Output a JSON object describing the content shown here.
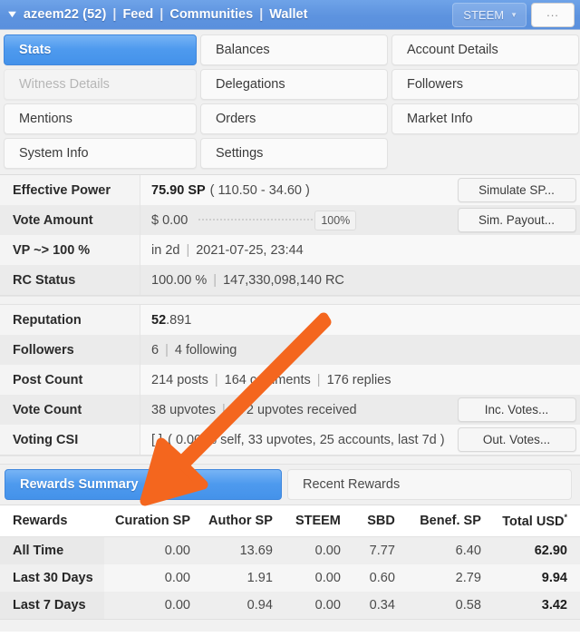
{
  "titlebar": {
    "caret_icon": "caret-down-icon",
    "user": "azeem22 (52)",
    "nav": [
      "Feed",
      "Communities",
      "Wallet"
    ],
    "separator": "|",
    "network_label": "STEEM",
    "network_caret_icon": "caret-down-icon",
    "more_label": "...",
    "accent": "#5d93df"
  },
  "tabs": {
    "rows": [
      [
        {
          "label": "Stats",
          "state": "active"
        },
        {
          "label": "Balances",
          "state": "normal"
        },
        {
          "label": "Account Details",
          "state": "normal"
        }
      ],
      [
        {
          "label": "Witness Details",
          "state": "disabled"
        },
        {
          "label": "Delegations",
          "state": "normal"
        },
        {
          "label": "Followers",
          "state": "normal"
        }
      ],
      [
        {
          "label": "Mentions",
          "state": "normal"
        },
        {
          "label": "Orders",
          "state": "normal"
        },
        {
          "label": "Market Info",
          "state": "normal"
        }
      ],
      [
        {
          "label": "System Info",
          "state": "normal"
        },
        {
          "label": "Settings",
          "state": "normal"
        },
        {
          "label": "",
          "state": "empty"
        }
      ]
    ],
    "active_color": "#4492ea"
  },
  "stats_group_1": [
    {
      "label": "Effective Power",
      "value_bold": "75.90 SP",
      "value_rest": "( 110.50 - 34.60 )",
      "button": "Simulate SP..."
    },
    {
      "label": "Vote Amount",
      "value_bold": "$ 0.00",
      "slider_percent": "100%",
      "button": "Sim. Payout..."
    },
    {
      "label": "VP ~> 100 %",
      "value_bold": "in 2d",
      "value_rest": "2021-07-25, 23:44",
      "button": ""
    },
    {
      "label": "RC Status",
      "value_bold": "100.00 %",
      "value_rest": "147,330,098,140 RC",
      "button": ""
    }
  ],
  "stats_group_2": [
    {
      "label": "Reputation",
      "value_bold": "52",
      "value_rest": ".891",
      "button": ""
    },
    {
      "label": "Followers",
      "value_bold": "6",
      "value_rest": "4 following",
      "button": ""
    },
    {
      "label": "Post Count",
      "value_bold": "214 posts",
      "value_mid": "164 comments",
      "value_rest": "176 replies",
      "button": ""
    },
    {
      "label": "Vote Count",
      "value_bold": "38 upvotes",
      "value_rest": "472 upvotes received",
      "button": "Inc. Votes..."
    },
    {
      "label": "Voting CSI",
      "value_bold": "[ ]",
      "value_rest": "( 0.00 % self, 33 upvotes, 25 accounts, last 7d )",
      "button": "Out. Votes..."
    }
  ],
  "rewards_tabs": [
    {
      "label": "Rewards Summary",
      "state": "active"
    },
    {
      "label": "Recent Rewards",
      "state": "normal"
    }
  ],
  "rewards_table": {
    "headers": [
      "Rewards",
      "Curation SP",
      "Author SP",
      "STEEM",
      "SBD",
      "Benef. SP",
      "Total USD"
    ],
    "total_header_superscript": "*",
    "rows": [
      {
        "label": "All Time",
        "curation_sp": "0.00",
        "author_sp": "13.69",
        "steem": "0.00",
        "sbd": "7.77",
        "benef_sp": "6.40",
        "total_usd": "62.90"
      },
      {
        "label": "Last 30 Days",
        "curation_sp": "0.00",
        "author_sp": "1.91",
        "steem": "0.00",
        "sbd": "0.60",
        "benef_sp": "2.79",
        "total_usd": "9.94"
      },
      {
        "label": "Last 7 Days",
        "curation_sp": "0.00",
        "author_sp": "0.94",
        "steem": "0.00",
        "sbd": "0.34",
        "benef_sp": "0.58",
        "total_usd": "3.42"
      }
    ]
  },
  "annotation": {
    "arrow_color": "#f4661e",
    "arrow_name": "orange-annotation-arrow"
  }
}
